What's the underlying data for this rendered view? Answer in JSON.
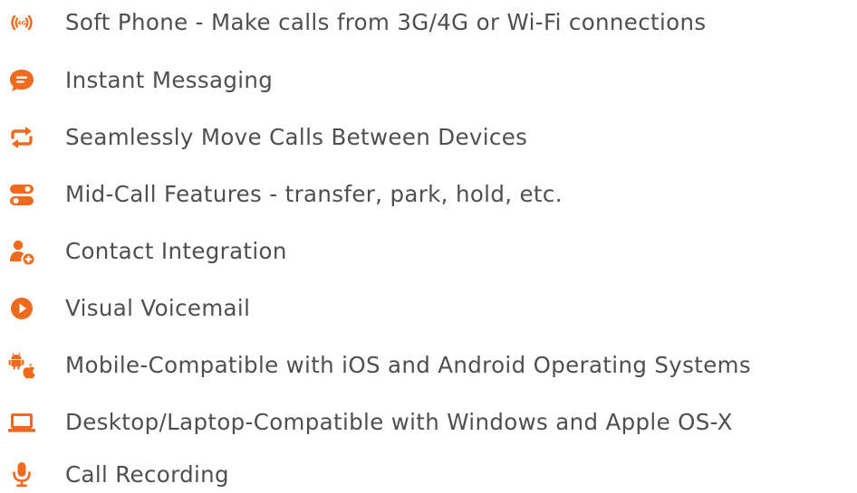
{
  "accent_color": "#ee6a1c",
  "text_color": "#4f4f4f",
  "features": [
    {
      "icon": "signal-4g-icon",
      "label": "Soft Phone - Make calls from 3G/4G or Wi-Fi connections"
    },
    {
      "icon": "chat-bubble-icon",
      "label": "Instant Messaging"
    },
    {
      "icon": "swap-arrows-icon",
      "label": "Seamlessly Move Calls Between Devices"
    },
    {
      "icon": "toggle-switches-icon",
      "label": "Mid-Call Features - transfer, park, hold, etc."
    },
    {
      "icon": "add-contact-icon",
      "label": "Contact Integration"
    },
    {
      "icon": "play-circle-icon",
      "label": "Visual Voicemail"
    },
    {
      "icon": "android-apple-icon",
      "label": "Mobile-Compatible with iOS and Android Operating Systems"
    },
    {
      "icon": "laptop-icon",
      "label": "Desktop/Laptop-Compatible with Windows and Apple OS-X"
    },
    {
      "icon": "microphone-icon",
      "label": "Call Recording"
    }
  ]
}
